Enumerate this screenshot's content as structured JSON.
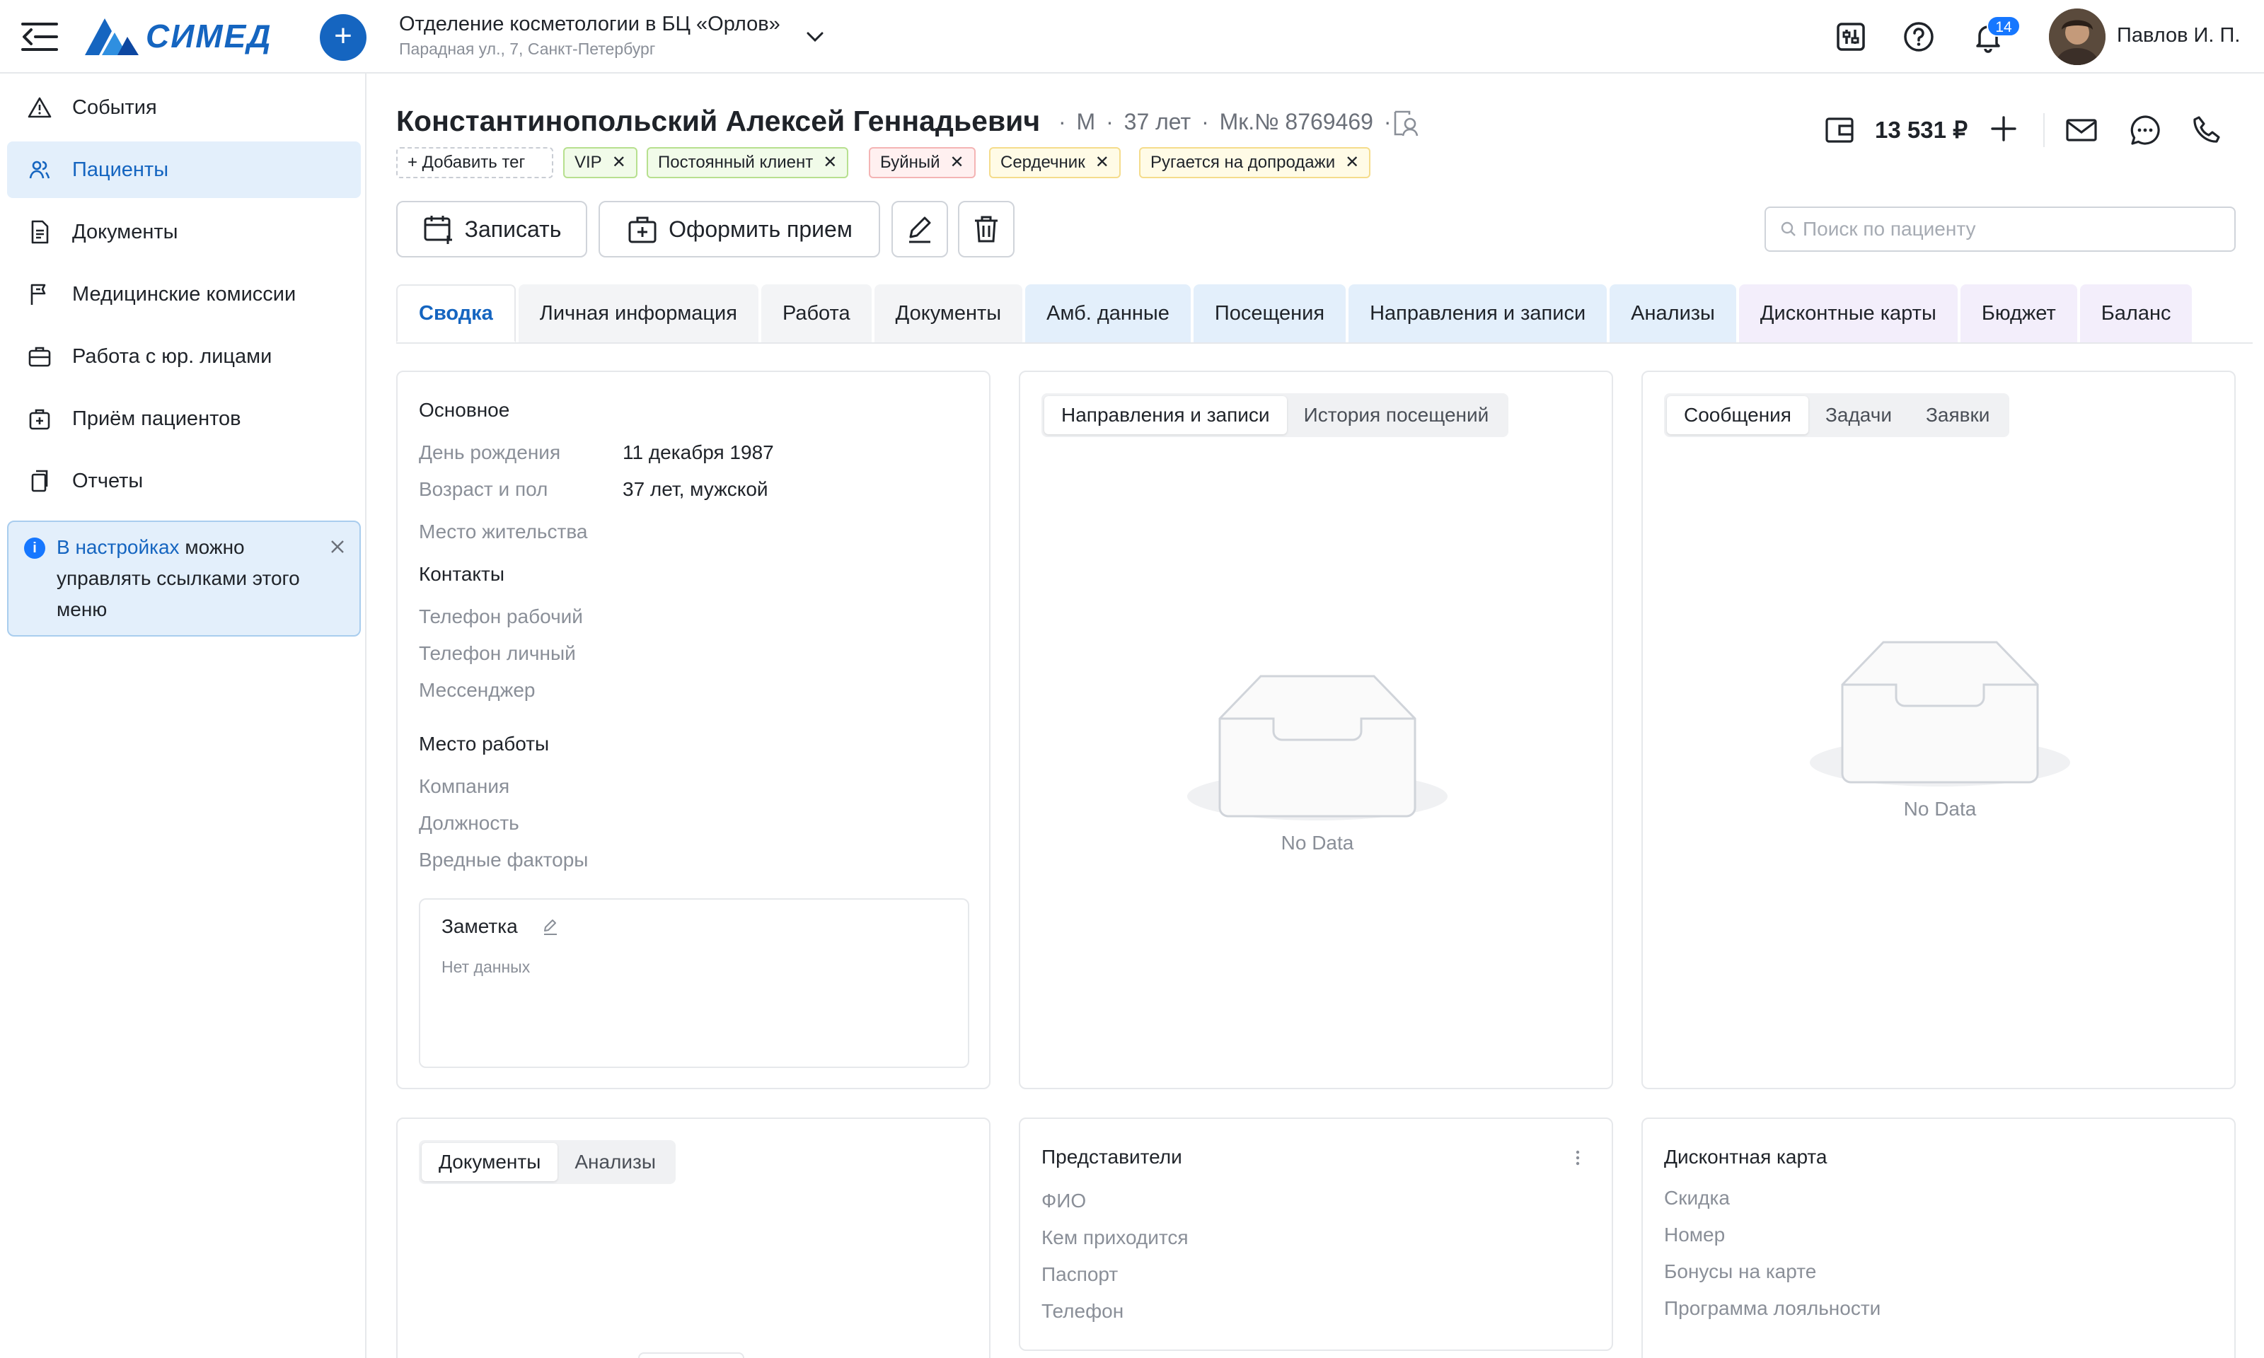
{
  "header": {
    "logo_text": "СИМЕД",
    "clinic_name": "Отделение косметологии в БЦ «Орлов»",
    "clinic_address": "Парадная ул., 7, Санкт-Петербург",
    "notifications_count": "14",
    "user_name": "Павлов И. П."
  },
  "sidebar": {
    "items": [
      {
        "label": "События",
        "icon": "alert-triangle-icon"
      },
      {
        "label": "Пациенты",
        "icon": "users-icon"
      },
      {
        "label": "Документы",
        "icon": "document-icon"
      },
      {
        "label": "Медицинские комиссии",
        "icon": "flag-icon"
      },
      {
        "label": "Работа с юр. лицами",
        "icon": "briefcase-icon"
      },
      {
        "label": "Приём пациентов",
        "icon": "medical-bag-icon"
      },
      {
        "label": "Отчеты",
        "icon": "copy-icon"
      }
    ],
    "active_index": 1,
    "info": {
      "link_text": "В настройках",
      "text": "можно управлять ссылками этого меню"
    }
  },
  "patient": {
    "name": "Константинопольский Алексей Геннадьевич",
    "sex": "М",
    "age": "37 лет",
    "card_no": "Мк.№ 8769469",
    "balance": "13 531 ₽",
    "add_tag_label": "+ Добавить тег",
    "tags": [
      {
        "label": "VIP",
        "bg": "#f1fbe9",
        "border": "#b7e08f"
      },
      {
        "label": "Постоянный клиент",
        "bg": "#f1fbe9",
        "border": "#b7e08f"
      },
      {
        "label": "Буйный",
        "bg": "#fff0f0",
        "border": "#f4b4b4"
      },
      {
        "label": "Сердечник",
        "bg": "#fffbe6",
        "border": "#f5dc8c"
      },
      {
        "label": "Ругается на допродажи",
        "bg": "#fffbe6",
        "border": "#f5dc8c"
      }
    ]
  },
  "actions": {
    "record_label": "Записать",
    "reception_label": "Оформить прием",
    "search_placeholder": "Поиск по пациенту",
    "search_value": ""
  },
  "tabs": [
    {
      "label": "Сводка",
      "style": "active"
    },
    {
      "label": "Личная информация",
      "style": "gray"
    },
    {
      "label": "Работа",
      "style": "gray"
    },
    {
      "label": "Документы",
      "style": "gray"
    },
    {
      "label": "Амб. данные",
      "style": "blue"
    },
    {
      "label": "Посещения",
      "style": "blue"
    },
    {
      "label": "Направления и записи",
      "style": "blue"
    },
    {
      "label": "Анализы",
      "style": "blue"
    },
    {
      "label": "Дисконтные карты",
      "style": "purple"
    },
    {
      "label": "Бюджет",
      "style": "purple"
    },
    {
      "label": "Баланс",
      "style": "purple"
    }
  ],
  "main_info": {
    "section_basic": "Основное",
    "birthday_label": "День рождения",
    "birthday_value": "11 декабря 1987",
    "age_sex_label": "Возраст и пол",
    "age_sex_value": "37 лет, мужской",
    "residence_label": "Место жительства",
    "section_contacts": "Контакты",
    "work_phone_label": "Телефон рабочий",
    "personal_phone_label": "Телефон личный",
    "messenger_label": "Мессенджер",
    "section_work": "Место работы",
    "company_label": "Компания",
    "position_label": "Должность",
    "hazards_label": "Вредные факторы",
    "note_title": "Заметка",
    "note_empty": "Нет данных"
  },
  "referrals_card": {
    "seg": [
      "Направления и записи",
      "История посещений"
    ],
    "no_data": "No Data"
  },
  "messages_card": {
    "seg": [
      "Сообщения",
      "Задачи",
      "Заявки"
    ],
    "no_data": "No Data"
  },
  "documents_card": {
    "seg": [
      "Документы",
      "Анализы"
    ]
  },
  "representatives_card": {
    "title": "Представители",
    "fields": [
      "ФИО",
      "Кем приходится",
      "Паспорт",
      "Телефон"
    ]
  },
  "discount_card": {
    "title": "Дисконтная карта",
    "fields": [
      "Скидка",
      "Номер",
      "Бонусы на карте",
      "Программа лояльности"
    ]
  },
  "colors": {
    "accent": "#1565c0",
    "active_bg": "#e3effb"
  }
}
